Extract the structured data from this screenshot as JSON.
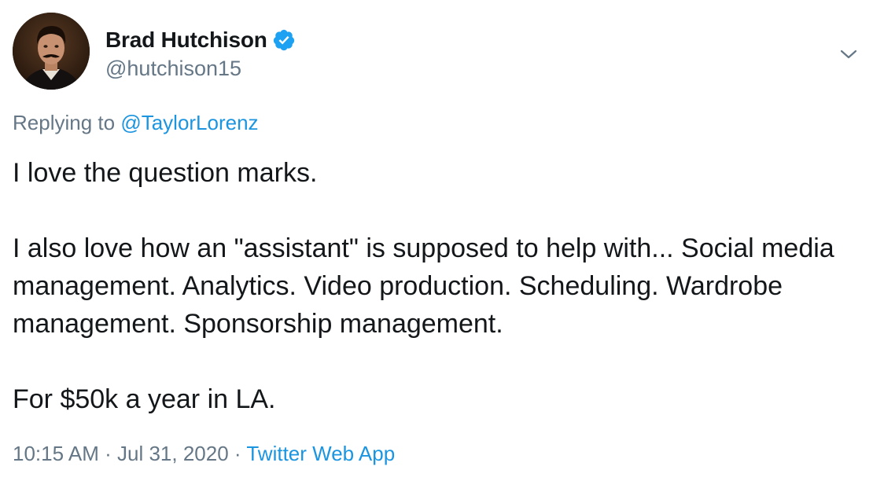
{
  "author": {
    "name": "Brad Hutchison",
    "handle": "@hutchison15",
    "verified": true
  },
  "reply": {
    "prefix": "Replying to",
    "target": "@TaylorLorenz"
  },
  "tweet": {
    "paragraphs": [
      "I love the question marks.",
      "I also love how an \"assistant\" is supposed to help with... Social media management. Analytics. Video production. Scheduling. Wardrobe management. Sponsorship management.",
      "For $50k a year in LA."
    ]
  },
  "meta": {
    "time": "10:15 AM",
    "separator": "·",
    "date": "Jul 31, 2020",
    "source": "Twitter Web App"
  },
  "icons": {
    "verified": "verified-badge-icon",
    "menu": "chevron-down-icon"
  },
  "colors": {
    "text": "#14171a",
    "muted": "#657786",
    "link": "#1b95e0",
    "verified": "#1da1f2"
  }
}
